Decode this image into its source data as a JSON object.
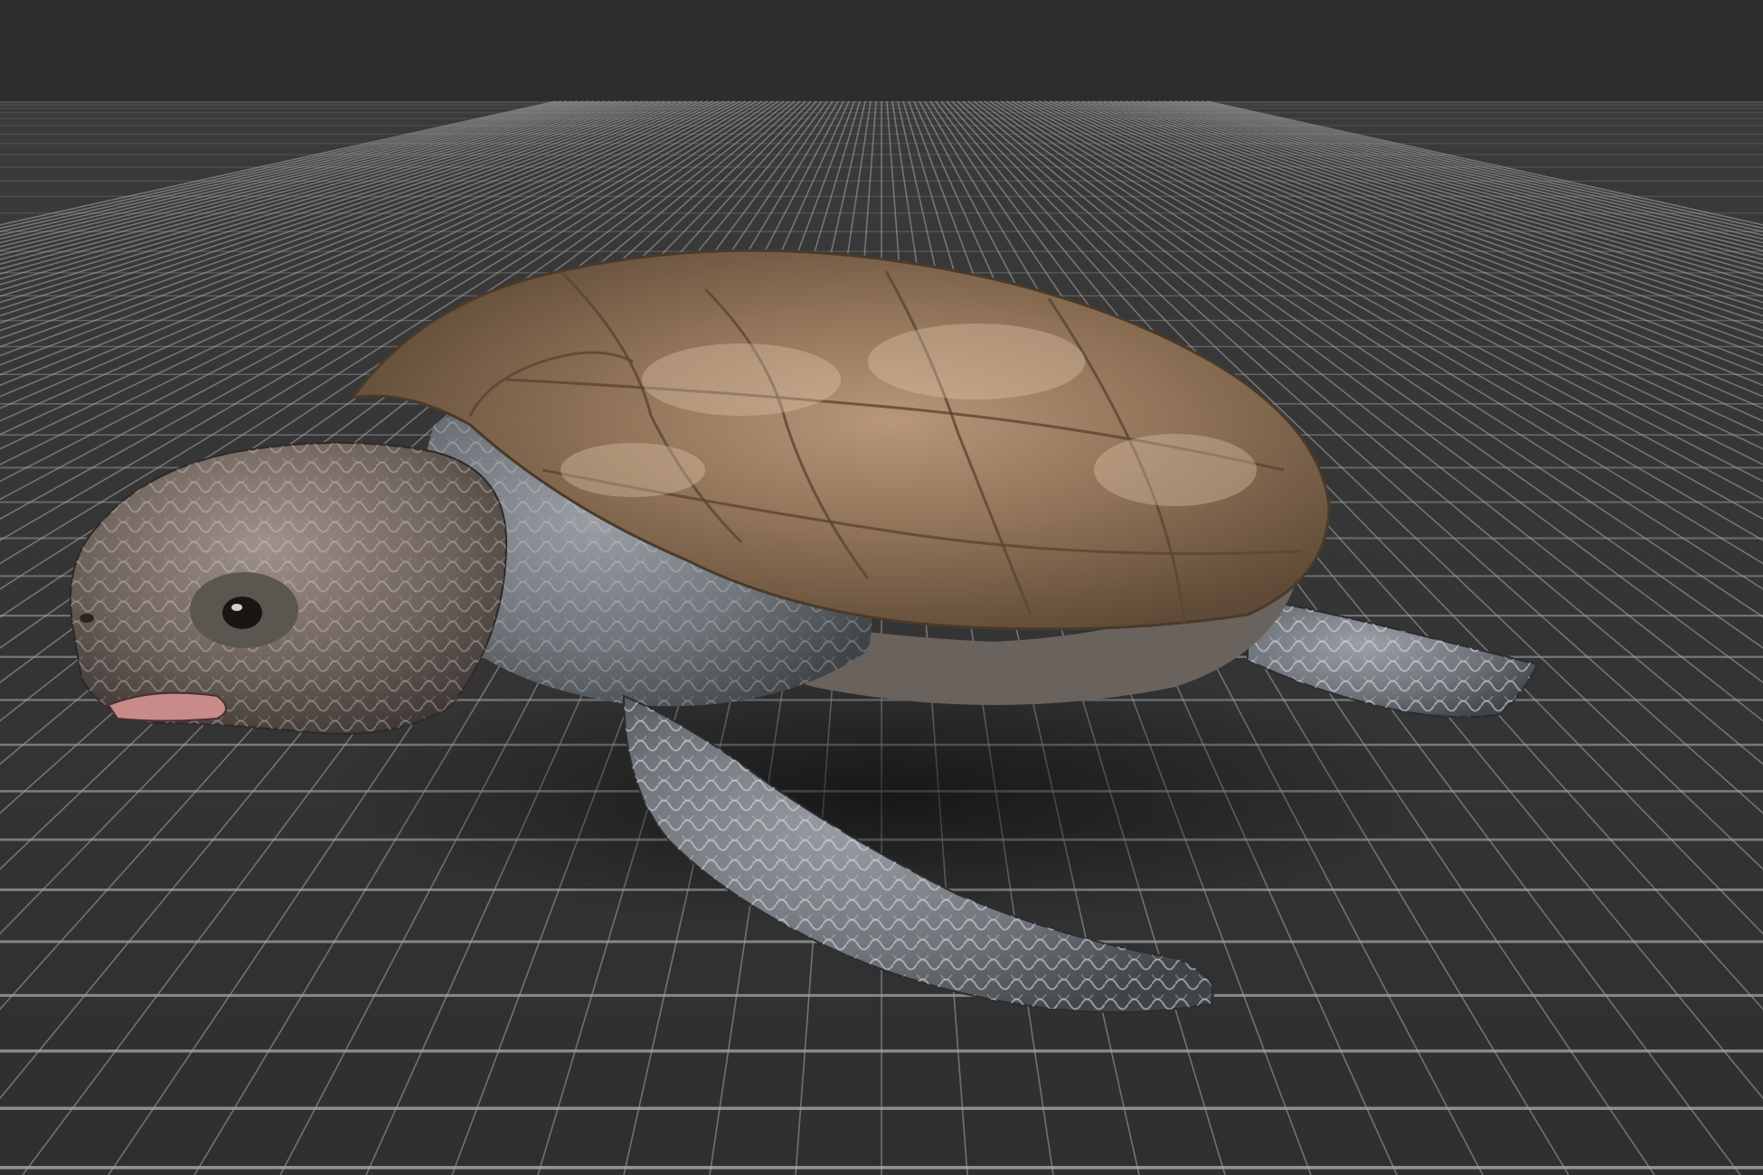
{
  "viewport": {
    "background_color": "#2d2d2d",
    "floor_color": "#333333",
    "grid_line_color": "#a8a8a8",
    "grid_visible": true,
    "camera": "perspective"
  },
  "model": {
    "subject": "sea turtle",
    "shell_color": "#8a7054",
    "skin_color": "#6f7478",
    "mouth_color": "#c98a8a"
  }
}
